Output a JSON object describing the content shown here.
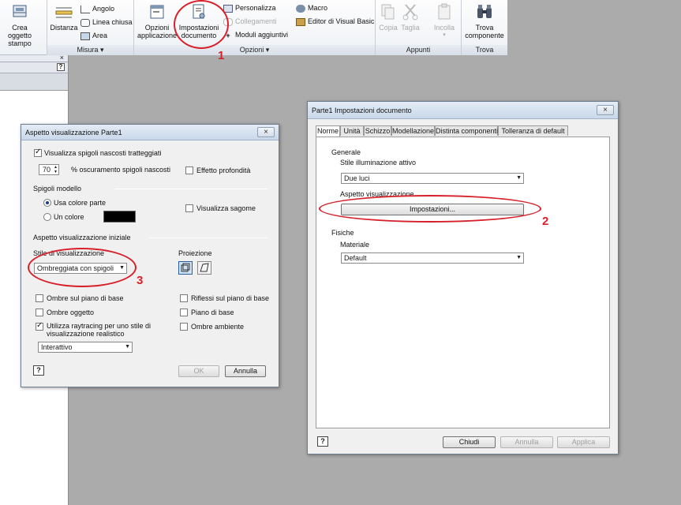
{
  "ribbon": {
    "crea_label": "Crea\noggetto stampo",
    "distanza_label": "Distanza",
    "misura_items": [
      "Angolo",
      "Linea chiusa",
      "Area"
    ],
    "misura_group": "Misura",
    "opzioni_app_label": "Opzioni\napplicazione",
    "impostazioni_doc_label": "Impostazioni\ndocumento",
    "opzioni_small": [
      "Personalizza",
      "Collegamenti",
      "Moduli aggiuntivi"
    ],
    "opzioni_small2": [
      "Macro",
      "Editor di Visual Basic"
    ],
    "opzioni_group": "Opzioni",
    "copia_label": "Copia",
    "taglia_label": "Taglia",
    "incolla_label": "Incolla",
    "appunti_group": "Appunti",
    "trova_label": "Trova\ncomponente",
    "trova_group": "Trova"
  },
  "dialog_aspetto": {
    "title": "Aspetto visualizzazione Parte1",
    "spigoli_nascosti": "Visualizza spigoli nascosti tratteggiati",
    "oscuramento_value": "70",
    "oscuramento_label": "% oscuramento spigoli nascosti",
    "effetto_profondita": "Effetto profondità",
    "spigoli_modello": "Spigoli modello",
    "usa_colore_parte": "Usa colore parte",
    "un_colore": "Un colore",
    "visualizza_sagome": "Visualizza sagome",
    "aspetto_iniziale": "Aspetto visualizzazione iniziale",
    "stile_visualizzazione": "Stile di visualizzazione",
    "stile_value": "Ombreggiata con spigoli",
    "proiezione": "Proiezione",
    "ombre_piano_base": "Ombre sul piano di base",
    "ombre_oggetto": "Ombre oggetto",
    "raytracing": "Utilizza raytracing per uno stile di\nvisualizzazione realistico",
    "raytracing_mode": "Interattivo",
    "riflessi": "Riflessi sul piano di base",
    "piano_base": "Piano di base",
    "ombre_ambiente": "Ombre ambiente",
    "ok": "OK",
    "annulla": "Annulla"
  },
  "dialog_impostazioni": {
    "title": "Parte1 Impostazioni documento",
    "tabs": [
      "Norme",
      "Unità",
      "Schizzo",
      "Modellazione",
      "Distinta componenti",
      "Tolleranza di default"
    ],
    "generale": "Generale",
    "stile_illuminazione": "Stile illuminazione attivo",
    "illuminazione_value": "Due luci",
    "aspetto_visualizzazione": "Aspetto visualizzazione",
    "impostazioni_button": "Impostazioni...",
    "fisiche": "Fisiche",
    "materiale": "Materiale",
    "materiale_value": "Default",
    "chiudi": "Chiudi",
    "annulla": "Annulla",
    "applica": "Applica"
  },
  "annotations": [
    "1",
    "2",
    "3"
  ],
  "colors": {
    "annotation": "#d8202a",
    "dialog_bg": "#f0f0f0",
    "workspace": "#ababab"
  }
}
